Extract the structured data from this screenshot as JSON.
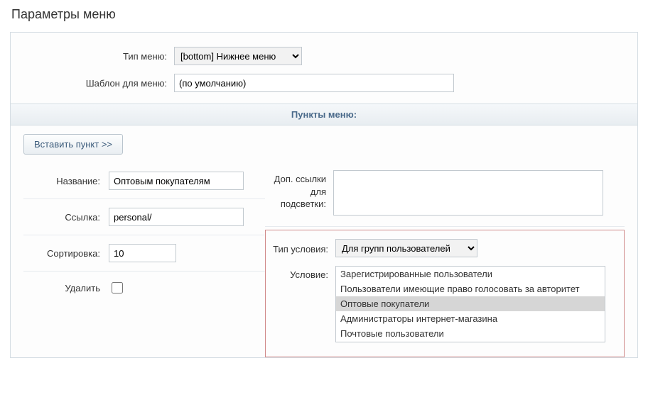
{
  "page_title": "Параметры меню",
  "top": {
    "menu_type_label": "Тип меню:",
    "menu_type_value": "[bottom] Нижнее меню",
    "template_label": "Шаблон для меню:",
    "template_value": "(по умолчанию)"
  },
  "section_header": "Пункты меню:",
  "insert_button": "Вставить пункт >>",
  "left": {
    "name_label": "Название:",
    "name_value": "Оптовым покупателям",
    "link_label": "Ссылка:",
    "link_value": "personal/",
    "sort_label": "Сортировка:",
    "sort_value": "10",
    "delete_label": "Удалить"
  },
  "right": {
    "addlinks_label": "Доп. ссылки для подсветки:",
    "addlinks_value": "",
    "condtype_label": "Тип условия:",
    "condtype_value": "Для групп пользователей",
    "condition_label": "Условие:",
    "condition_options": [
      "Зарегистрированные пользователи",
      "Пользователи имеющие право голосовать за авторитет",
      "Оптовые покупатели",
      "Администраторы интернет-магазина",
      "Почтовые пользователи"
    ],
    "condition_selected_index": 2
  }
}
